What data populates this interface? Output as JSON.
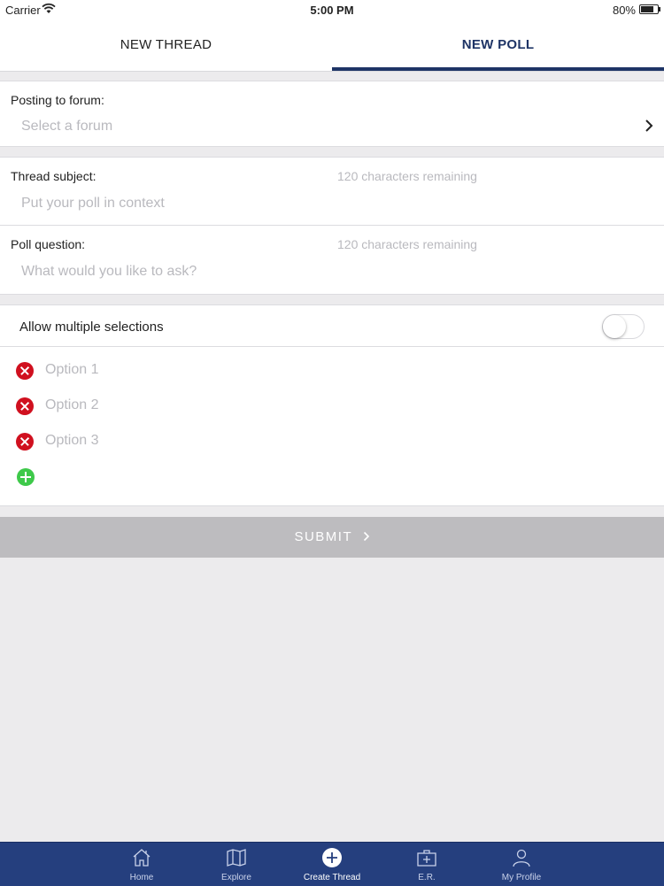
{
  "status_bar": {
    "carrier": "Carrier",
    "time": "5:00 PM",
    "battery": "80%",
    "battery_level": 0.8
  },
  "tabs": [
    {
      "label": "NEW THREAD",
      "active": false
    },
    {
      "label": "NEW POLL",
      "active": true
    }
  ],
  "forum": {
    "label": "Posting to forum:",
    "placeholder": "Select a forum"
  },
  "thread_subject": {
    "label": "Thread subject:",
    "remaining": "120 characters remaining",
    "placeholder": "Put your poll in context"
  },
  "poll_question": {
    "label": "Poll question:",
    "remaining": "120 characters remaining",
    "placeholder": "What would you like to ask?"
  },
  "multiple": {
    "label": "Allow multiple selections",
    "enabled": false
  },
  "options": [
    {
      "placeholder": "Option 1"
    },
    {
      "placeholder": "Option 2"
    },
    {
      "placeholder": "Option 3"
    }
  ],
  "submit": {
    "label": "SUBMIT"
  },
  "nav": [
    {
      "label": "Home",
      "icon": "home-icon"
    },
    {
      "label": "Explore",
      "icon": "map-icon"
    },
    {
      "label": "Create Thread",
      "icon": "plus-circle-icon"
    },
    {
      "label": "E.R.",
      "icon": "first-aid-icon"
    },
    {
      "label": "My Profile",
      "icon": "person-icon"
    }
  ],
  "colors": {
    "accent": "#1e3466",
    "nav_bg": "#253f7e",
    "remove": "#d0101f",
    "add": "#3ec94a",
    "submit_bg": "#bdbcbf"
  }
}
